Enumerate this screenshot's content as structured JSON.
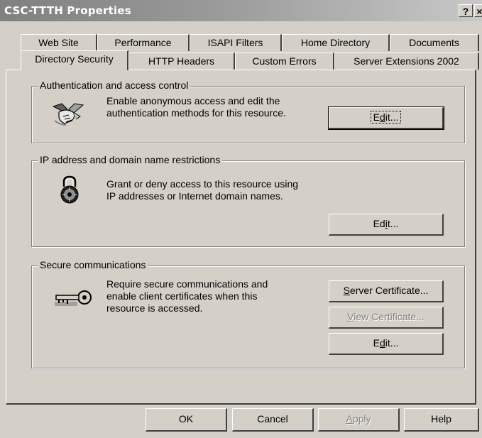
{
  "window": {
    "title": "CSC-TTTH Properties",
    "help_button": "?",
    "close_button": "×"
  },
  "tabs_row1": [
    "Web Site",
    "Performance",
    "ISAPI Filters",
    "Home Directory",
    "Documents"
  ],
  "tabs_row2": [
    "Directory Security",
    "HTTP Headers",
    "Custom Errors",
    "Server Extensions 2002"
  ],
  "active_tab": "Directory Security",
  "sections": {
    "auth": {
      "label": "Authentication and access control",
      "description": "Enable anonymous access and edit the\nauthentication methods for this resource.",
      "icon": "handshake-icon",
      "edit_prefix": "E",
      "edit_underline": "d",
      "edit_suffix": "it..."
    },
    "ip": {
      "label": "IP address and domain name restrictions",
      "description": "Grant or deny access to this resource using\nIP addresses or Internet domain names.",
      "icon": "padlock-icon",
      "edit_prefix": "Ed",
      "edit_underline": "i",
      "edit_suffix": "t..."
    },
    "secure": {
      "label": "Secure communications",
      "description": "Require secure communications and\nenable client certificates when this\nresource is accessed.",
      "icon": "key-icon",
      "server_cert_underline": "S",
      "server_cert_rest": "erver Certificate...",
      "view_cert_underline": "V",
      "view_cert_rest": "iew Certificate...",
      "edit_prefix": "E",
      "edit_underline": "d",
      "edit_suffix": "it..."
    }
  },
  "footer": {
    "ok": "OK",
    "cancel": "Cancel",
    "apply_underline": "A",
    "apply_rest": "pply",
    "help": "Help"
  },
  "colors": {
    "face": "#d4d0c8",
    "shadow": "#404040",
    "disabled_text": "#808080"
  }
}
